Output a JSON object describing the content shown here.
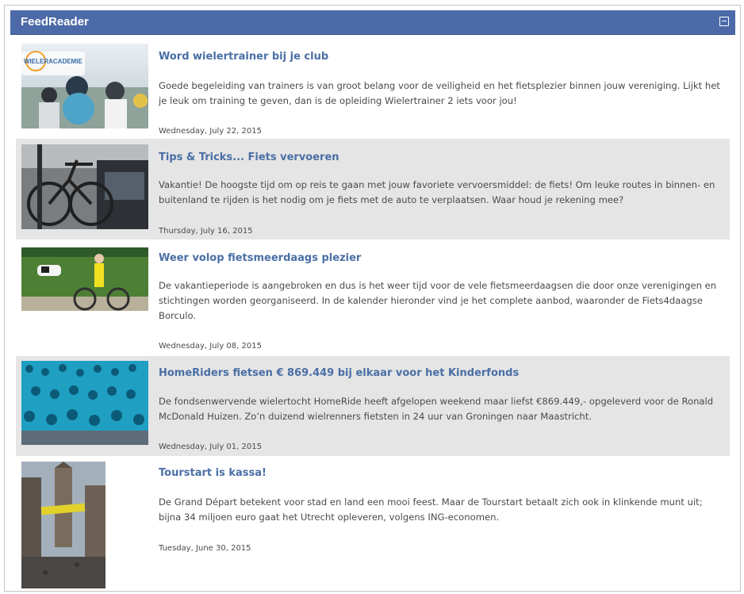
{
  "widget": {
    "title": "FeedReader"
  },
  "items": [
    {
      "title": "Word wielertrainer bij je club",
      "description": "Goede begeleiding van trainers is van groot belang voor de veiligheid en het fietsplezier binnen jouw vereniging. Lijkt het je leuk om training te geven, dan is de opleiding Wielertrainer 2 iets voor jou!",
      "date": "Wednesday, July 22, 2015",
      "thumb_logo": "WIELERACADEMIE"
    },
    {
      "title": "Tips & Tricks... Fiets vervoeren",
      "description": "Vakantie! De hoogste tijd om op reis te gaan met jouw favoriete vervoersmiddel: de fiets! Om leuke routes in binnen- en buitenland te rijden is het nodig om je fiets met de auto te verplaatsen. Waar houd je rekening mee?",
      "date": "Thursday, July 16, 2015"
    },
    {
      "title": "Weer volop fietsmeerdaags plezier",
      "description": "De vakantieperiode is aangebroken en dus is het weer tijd voor de vele fietsmeerdaagsen die door onze verenigingen en stichtingen worden georganiseerd. In de kalender hieronder vind je het complete aanbod, waaronder de Fiets4daagse Borculo.",
      "date": "Wednesday, July 08, 2015"
    },
    {
      "title": "HomeRiders fietsen € 869.449 bij elkaar voor het Kinderfonds",
      "description": "De fondsenwervende wielertocht HomeRide heeft afgelopen weekend maar liefst €869.449,- opgeleverd voor de Ronald McDonald Huizen. Zo’n duizend wielrenners fietsten in 24 uur van Groningen naar Maastricht.",
      "date": "Wednesday, July 01, 2015"
    },
    {
      "title": "Tourstart is kassa!",
      "description": "De Grand Départ betekent voor stad en land een mooi feest. Maar de Tourstart betaalt zich ook in klinkende munt uit; bijna 34 miljoen euro gaat het Utrecht opleveren, volgens ING-economen.",
      "date": "Tuesday, June 30, 2015"
    }
  ]
}
